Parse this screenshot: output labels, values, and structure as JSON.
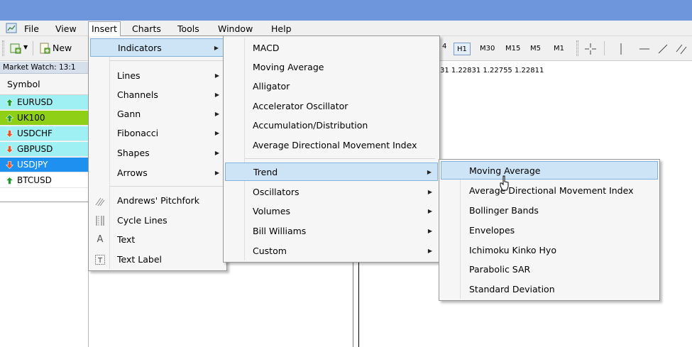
{
  "menubar": {
    "items": [
      "File",
      "View",
      "Insert",
      "Charts",
      "Tools",
      "Window",
      "Help"
    ]
  },
  "toolbar": {
    "new_label": "New",
    "timeframes": [
      "H1",
      "M30",
      "M15",
      "M5",
      "M1"
    ],
    "active_timeframe": "H1"
  },
  "market_watch": {
    "header": "Market Watch: 13:1",
    "column": "Symbol",
    "rows": [
      {
        "symbol": "EURUSD",
        "dir": "up",
        "bg": "#9ef0f2"
      },
      {
        "symbol": "UK100",
        "dir": "up",
        "bg": "#8fcf16"
      },
      {
        "symbol": "USDCHF",
        "dir": "down",
        "bg": "#9ef0f2"
      },
      {
        "symbol": "GBPUSD",
        "dir": "down",
        "bg": "#9ef0f2"
      },
      {
        "symbol": "USDJPY",
        "dir": "down",
        "bg": "#1e90f0"
      },
      {
        "symbol": "BTCUSD",
        "dir": "up",
        "bg": "#ffffff"
      }
    ]
  },
  "chart": {
    "price_text": "31 1.22831 1.22755 1.22811"
  },
  "insert_menu": {
    "items": [
      "Indicators",
      "Lines",
      "Channels",
      "Gann",
      "Fibonacci",
      "Shapes",
      "Arrows",
      "Andrews' Pitchfork",
      "Cycle Lines",
      "Text",
      "Text Label"
    ]
  },
  "indicators_menu": {
    "items": [
      "MACD",
      "Moving Average",
      "Alligator",
      "Accelerator Oscillator",
      "Accumulation/Distribution",
      "Average Directional Movement Index",
      "Trend",
      "Oscillators",
      "Volumes",
      "Bill Williams",
      "Custom"
    ]
  },
  "trend_menu": {
    "items": [
      "Moving Average",
      "Average Directional Movement Index",
      "Bollinger Bands",
      "Envelopes",
      "Ichimoku Kinko Hyo",
      "Parabolic SAR",
      "Standard Deviation"
    ]
  },
  "colors": {
    "title_bar": "#6e96dc",
    "highlight": "#cde4f7",
    "highlight_border": "#83b2e1",
    "up_arrow": "#1f9a2e",
    "down_arrow": "#e8542a"
  }
}
